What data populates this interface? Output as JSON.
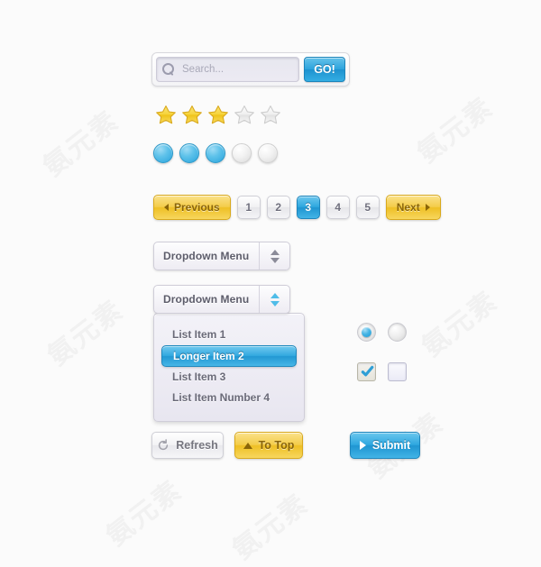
{
  "watermark": {
    "text": "氨元素"
  },
  "search": {
    "placeholder": "Search...",
    "value": "",
    "button_label": "GO!",
    "icon": "search-icon",
    "accent": "#2ca3dd"
  },
  "rating": {
    "total": 5,
    "filled": 3,
    "filled_color": "#f5cf33",
    "empty_color": "#d8d8d8"
  },
  "dots": {
    "total": 5,
    "active": 3,
    "active_color": "#2aa4dc",
    "inactive_color": "#dadada"
  },
  "pagination": {
    "previous_label": "Previous",
    "next_label": "Next",
    "pages": [
      "1",
      "2",
      "3",
      "4",
      "5"
    ],
    "current_page": "3",
    "gold_color": "#eebf24",
    "active_color": "#1f95d1"
  },
  "dropdown_closed": {
    "label": "Dropdown Menu",
    "arrow_icon": "chevron-updown-icon",
    "arrow_color": "#8b8b99"
  },
  "dropdown_open": {
    "label": "Dropdown Menu",
    "arrow_icon": "chevron-updown-icon",
    "arrow_color": "#4fbce8",
    "items": [
      {
        "label": "List Item 1",
        "selected": false
      },
      {
        "label": "Longer Item 2",
        "selected": true
      },
      {
        "label": "List Item 3",
        "selected": false
      },
      {
        "label": "List Item Number 4",
        "selected": false
      }
    ]
  },
  "radios": [
    {
      "checked": true
    },
    {
      "checked": false
    }
  ],
  "checkboxes": [
    {
      "checked": true
    },
    {
      "checked": false
    }
  ],
  "buttons": {
    "refresh": {
      "label": "Refresh",
      "icon": "refresh-icon"
    },
    "to_top": {
      "label": "To Top",
      "icon": "triangle-up-icon"
    },
    "submit": {
      "label": "Submit",
      "icon": "triangle-right-icon"
    }
  }
}
